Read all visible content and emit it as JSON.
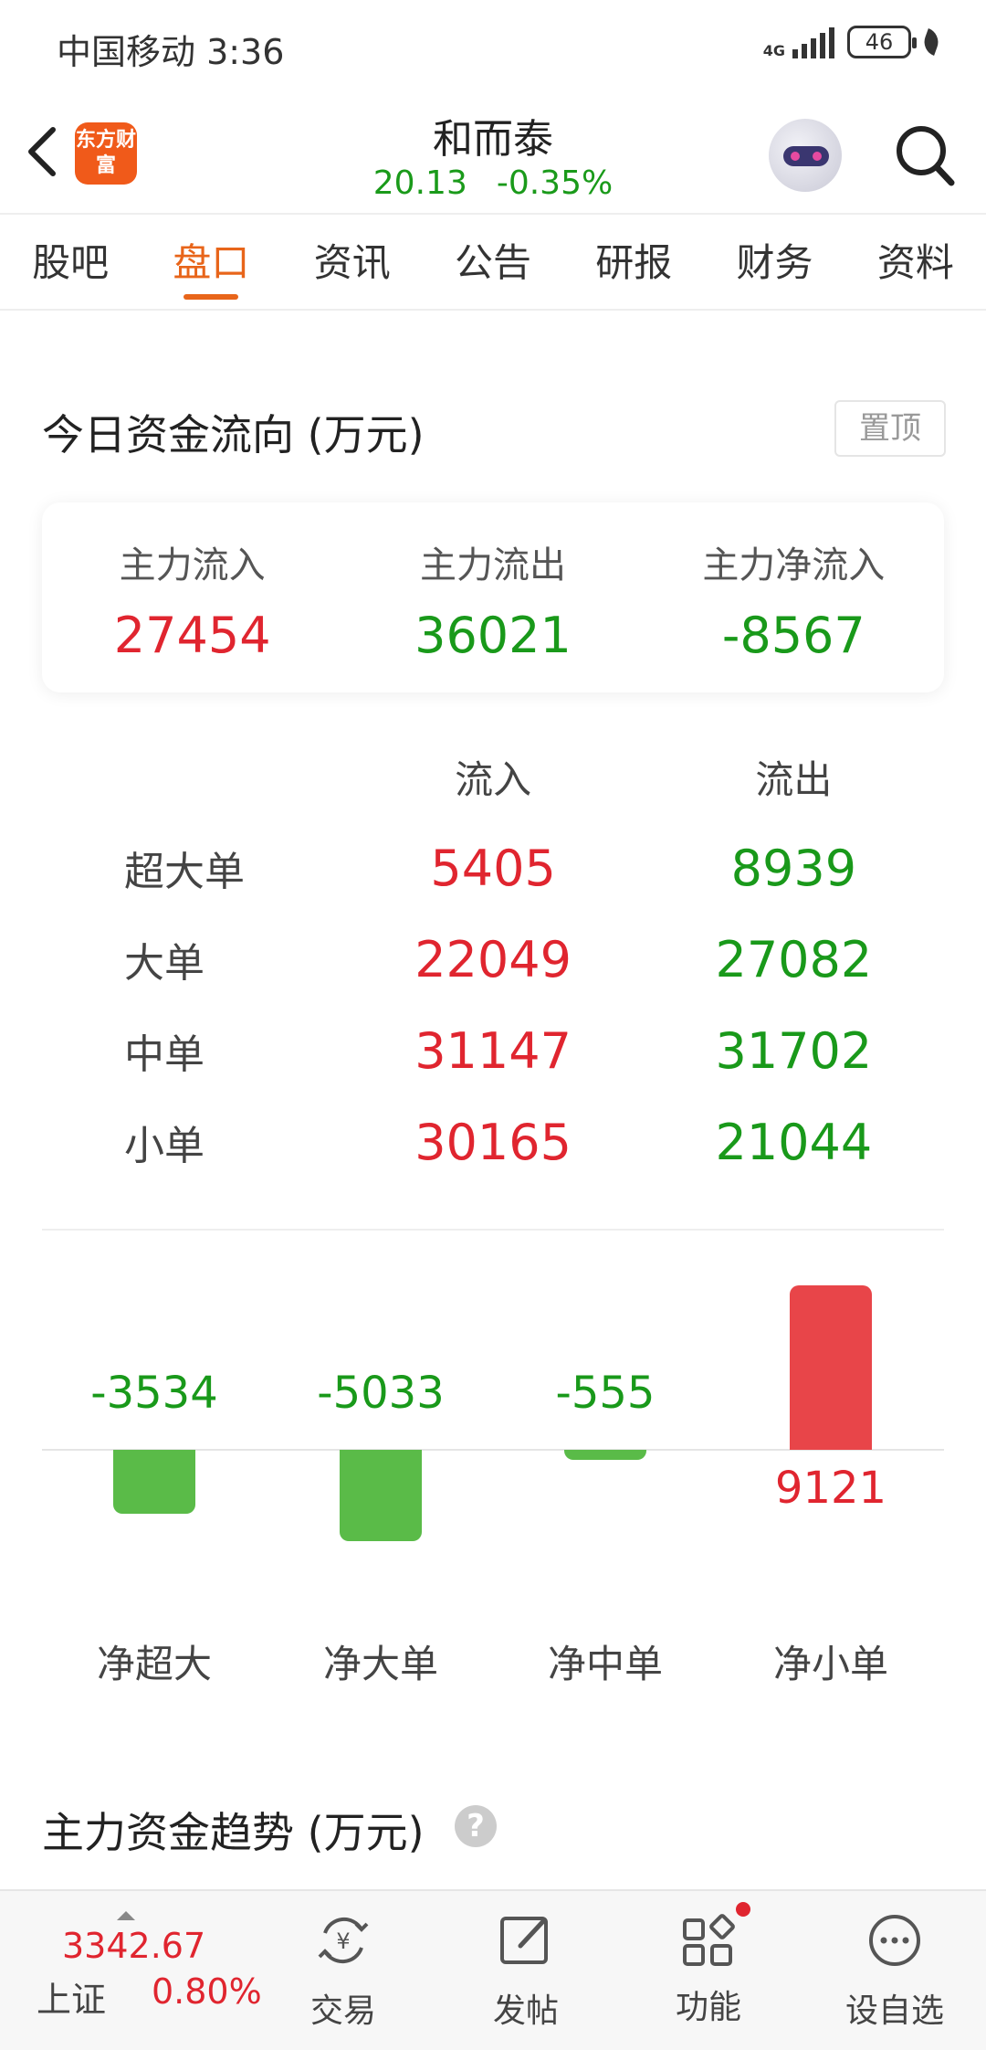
{
  "status_bar": {
    "carrier_time": "中国移动 3:36",
    "network": "4G",
    "battery": "46"
  },
  "header": {
    "logo_text": "东方财富",
    "stock_name": "和而泰",
    "price": "20.13",
    "change_pct": "-0.35%"
  },
  "tabs": [
    {
      "label": "股吧"
    },
    {
      "label": "盘口"
    },
    {
      "label": "资讯"
    },
    {
      "label": "公告"
    },
    {
      "label": "研报"
    },
    {
      "label": "财务"
    },
    {
      "label": "资料"
    }
  ],
  "active_tab": "盘口",
  "fund_flow": {
    "title": "今日资金流向 (万元)",
    "pin_label": "置顶",
    "summary": [
      {
        "label": "主力流入",
        "value": "27454",
        "color": "#e0252f"
      },
      {
        "label": "主力流出",
        "value": "36021",
        "color": "#19991a"
      },
      {
        "label": "主力净流入",
        "value": "-8567",
        "color": "#19991a"
      }
    ],
    "table": {
      "headers": [
        "",
        "流入",
        "流出"
      ],
      "rows": [
        {
          "name": "超大单",
          "in": "5405",
          "out": "8939"
        },
        {
          "name": "大单",
          "in": "22049",
          "out": "27082"
        },
        {
          "name": "中单",
          "in": "31147",
          "out": "31702"
        },
        {
          "name": "小单",
          "in": "30165",
          "out": "21044"
        }
      ]
    }
  },
  "chart_data": {
    "type": "bar",
    "categories": [
      "净超大",
      "净大单",
      "净中单",
      "净小单"
    ],
    "values": [
      -3534,
      -5033,
      -555,
      9121
    ],
    "positive_color": "#e84549",
    "negative_color": "#5abb48"
  },
  "trend": {
    "title": "主力资金趋势 (万元)",
    "help": "?"
  },
  "bottom_nav": {
    "index": {
      "value": "3342.67",
      "name": "上证",
      "pct": "0.80%"
    },
    "items": [
      {
        "label": "交易",
        "icon": "yen-exchange-icon"
      },
      {
        "label": "发帖",
        "icon": "compose-icon"
      },
      {
        "label": "功能",
        "icon": "apps-grid-icon"
      },
      {
        "label": "设自选",
        "icon": "more-dots-icon"
      }
    ]
  }
}
